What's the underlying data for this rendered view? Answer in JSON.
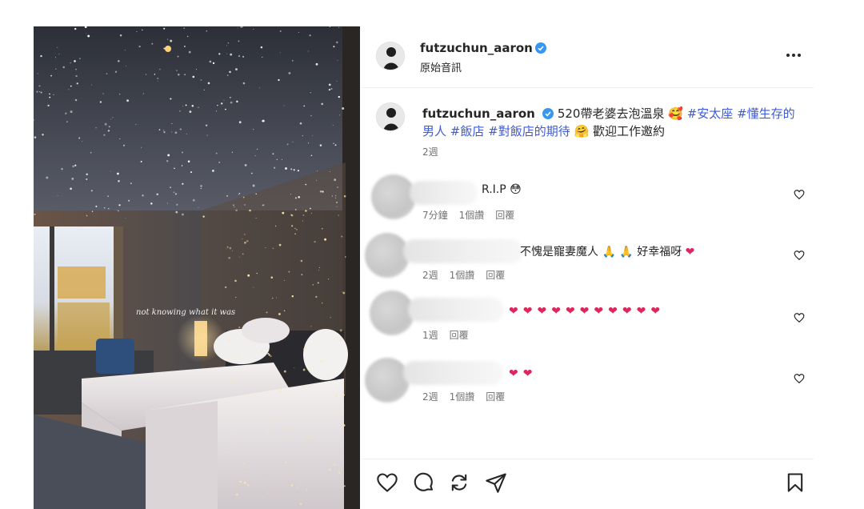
{
  "post": {
    "username": "futzuchun_aaron",
    "audio_label": "原始音訊",
    "image_watermark": "not knowing what it was"
  },
  "caption": {
    "username": "futzuchun_aaron",
    "text_part1": "520帶老婆去泡溫泉",
    "tag1": "#安太座",
    "tag2": "#懂生存的男人",
    "tag3": "#飯店",
    "tag4": "#對飯店的期待",
    "text_part2": "歡迎工作邀約",
    "age": "2週"
  },
  "comments": [
    {
      "text": "R.I.P",
      "emoji": "😳",
      "age": "7分鐘",
      "likes": "1個讚",
      "reply": "回覆"
    },
    {
      "text": "不愧是寵妻魔人",
      "text2": "好幸福呀",
      "age": "2週",
      "likes": "1個讚",
      "reply": "回覆"
    },
    {
      "text": "",
      "hearts": [
        "❤",
        "❤",
        "❤",
        "❤",
        "❤",
        "❤",
        "❤",
        "❤",
        "❤",
        "❤",
        "❤"
      ],
      "age": "1週",
      "reply": "回覆"
    },
    {
      "text": "",
      "hearts": [
        "❤",
        "❤"
      ],
      "age": "2週",
      "likes": "1個讚",
      "reply": "回覆"
    }
  ],
  "icons": {
    "verified": "verified-badge-icon",
    "more": "more-options-icon",
    "like": "heart-icon",
    "comment": "comment-icon",
    "share": "share-icon",
    "send": "paper-plane-icon",
    "save": "bookmark-icon"
  },
  "colors": {
    "verified": "#3897f0",
    "heart": "#e0245e",
    "tag": "#3b5bdb"
  }
}
